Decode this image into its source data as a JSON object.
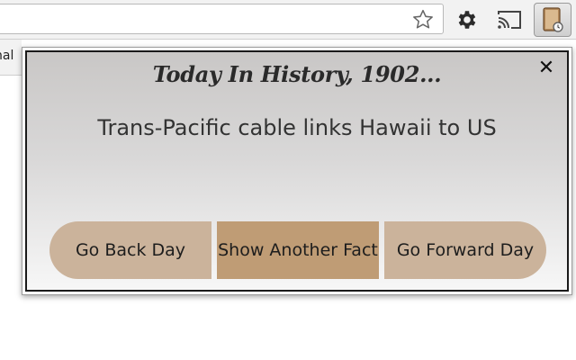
{
  "toolbar": {
    "icons": {
      "star": "star-icon",
      "gear": "gear-icon",
      "cast": "cast-icon",
      "extension": "history-book-icon"
    }
  },
  "bookmarks": {
    "fragment_label": "nal"
  },
  "popup": {
    "heading": "Today In History, 1902...",
    "fact": "Trans-Pacific cable links Hawaii to US",
    "close_label": "✕",
    "buttons": {
      "back": "Go Back Day",
      "show": "Show Another Fact",
      "forward": "Go Forward Day"
    },
    "colors": {
      "button_side": "#cbb39b",
      "button_center": "#bf9c75",
      "border": "#1a1a1a"
    }
  }
}
